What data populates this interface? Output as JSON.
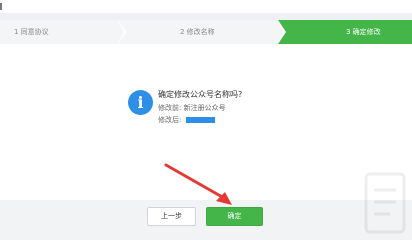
{
  "steps": [
    {
      "label": "1  同意协议"
    },
    {
      "label": "2  修改名称"
    },
    {
      "label": "3  确定修改"
    }
  ],
  "dialog": {
    "title": "确定修改公众号名称吗?",
    "before_label": "修改前:",
    "before_value": "新注册公众号",
    "after_label": "修改后:"
  },
  "buttons": {
    "prev": "上一步",
    "confirm": "确定"
  },
  "colors": {
    "accent": "#44b549",
    "info": "#2d8fe6",
    "annotation": "#e53935"
  },
  "icons": [
    "info-icon",
    "annotation-arrow-icon"
  ]
}
